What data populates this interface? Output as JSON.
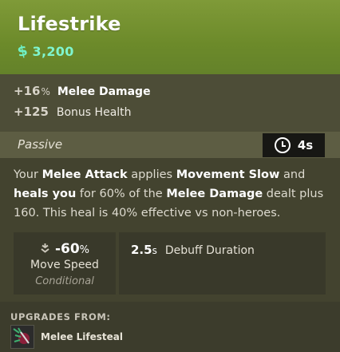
{
  "item": {
    "title": "Lifestrike",
    "price_icon": "currency-icon",
    "price": "3,200"
  },
  "stats": [
    {
      "value": "+16",
      "unit": "%",
      "name": "Melee Damage"
    },
    {
      "value": "+125",
      "unit": "",
      "name": "Bonus Health"
    }
  ],
  "passive": {
    "label": "Passive",
    "cooldown_icon": "cooldown-clock-icon",
    "cooldown": "4s"
  },
  "description": {
    "parts": [
      {
        "text": "Your ",
        "bold": false
      },
      {
        "text": "Melee Attack",
        "bold": true
      },
      {
        "text": " applies ",
        "bold": false
      },
      {
        "text": "Movement Slow",
        "bold": true
      },
      {
        "text": " and ",
        "bold": false
      },
      {
        "text": "heals you",
        "bold": true
      },
      {
        "text": " for 60% of the ",
        "bold": false
      },
      {
        "text": "Melee Damage",
        "bold": true
      },
      {
        "text": " dealt plus 160. This heal is 40% effective vs non-heroes.",
        "bold": false
      }
    ]
  },
  "move_speed": {
    "icon": "slow-icon",
    "value": "-60",
    "unit": "%",
    "name": "Move Speed",
    "condition": "Conditional"
  },
  "debuff": {
    "value": "2.5",
    "unit": "s",
    "name": "Debuff Duration"
  },
  "upgrades": {
    "title": "UPGRADES FROM:",
    "items": [
      {
        "name": "Melee Lifesteal",
        "icon": "melee-lifesteal-icon"
      }
    ]
  },
  "colors": {
    "header": "#6c8a2a",
    "price": "#7ff5cf",
    "body": "#43432f"
  }
}
